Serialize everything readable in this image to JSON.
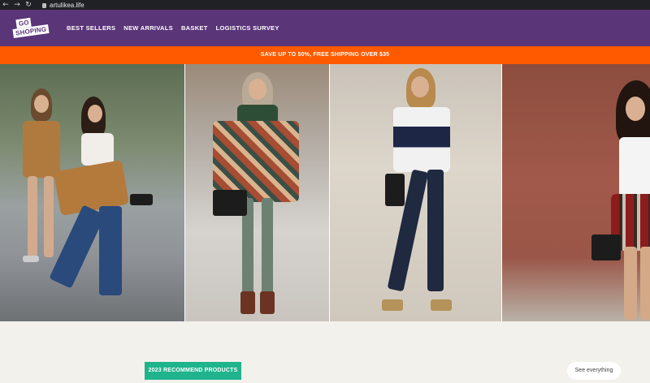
{
  "browser": {
    "back_icon": "arrow-left-icon",
    "forward_icon": "arrow-right-icon",
    "reload_icon": "reload-icon",
    "url": "artulikea.life"
  },
  "header": {
    "logo_top": "GO",
    "logo_bottom": "SHOPING",
    "nav": [
      {
        "label": "BEST SELLERS"
      },
      {
        "label": "NEW ARRIVALS"
      },
      {
        "label": "BASKET"
      },
      {
        "label": "LOGISTICS SURVEY"
      }
    ],
    "colors": {
      "header_bg": "#5a3578",
      "promo_bg": "#ff5a00",
      "accent": "#1fb48c"
    }
  },
  "promo": {
    "text": "SAVE UP TO 50%, FREE SHIPPING OVER $35"
  },
  "content": {
    "recommend_label": "2023 RECOMMEND PRODUCTS",
    "see_all_label": "See everything"
  }
}
